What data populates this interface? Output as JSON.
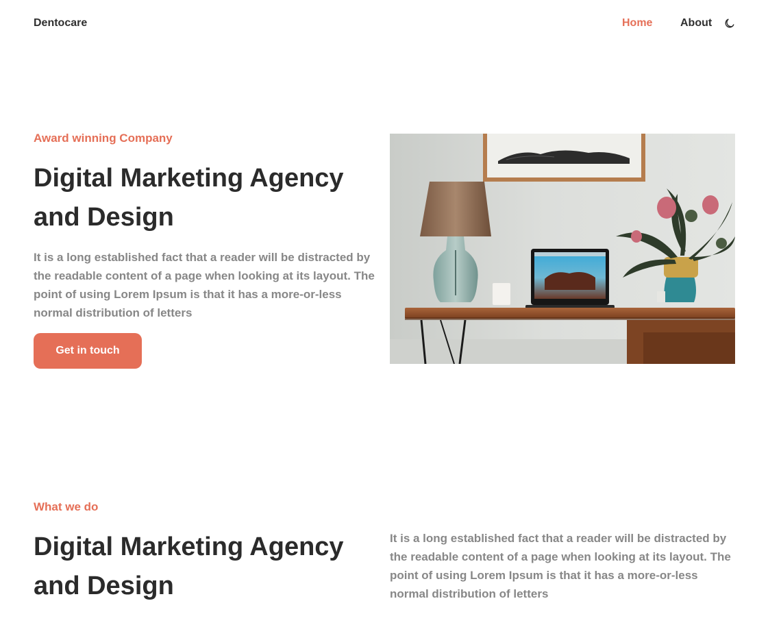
{
  "header": {
    "logo": "Dentocare",
    "nav": {
      "home": "Home",
      "about": "About"
    },
    "theme_toggle_icon": "moon-icon"
  },
  "hero": {
    "eyebrow": "Award winning Company",
    "heading_line1": "Digital Marketing Agency",
    "heading_line2": "and Design",
    "paragraph": "It is a long established fact that a reader will be distracted by the readable content of a page when looking at its layout. The point of using Lorem Ipsum is that it has a more-or-less normal distribution of letters",
    "cta_label": "Get in touch",
    "image_icon": "workspace-photo"
  },
  "services": {
    "eyebrow": "What we do",
    "heading_line1": "Digital Marketing Agency",
    "heading_line2": "and Design",
    "paragraph": "It is a long established fact that a reader will be distracted by the readable content of a page when looking at its layout. The point of using Lorem Ipsum is that it has a more-or-less normal distribution of letters"
  },
  "colors": {
    "accent": "#e56f57",
    "heading": "#2b2b2b",
    "body_text": "#878787"
  }
}
